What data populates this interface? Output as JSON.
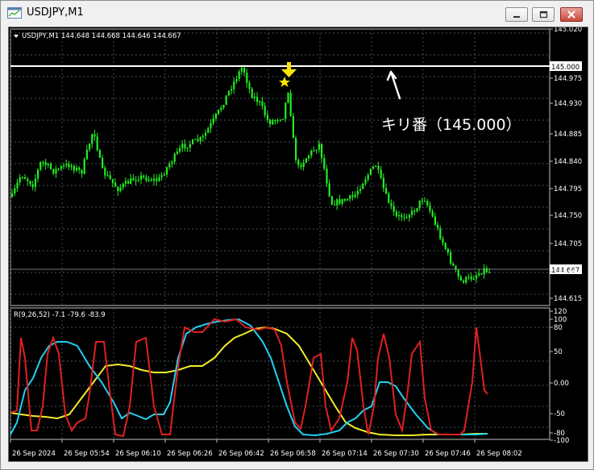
{
  "window": {
    "title": "USDJPY,M1"
  },
  "chart": {
    "header": "USDJPY,M1  144.648 144.668 144.646 144.667",
    "price_axis": {
      "ticks": [
        "145.020",
        "144.975",
        "144.930",
        "144.885",
        "144.840",
        "144.795",
        "144.750",
        "144.705",
        "144.660",
        "144.615"
      ],
      "level_label": "145.000",
      "current_label": "144.667"
    },
    "annotation": "キリ番（145.000）",
    "indicator": {
      "header": "R(9,26,52) -7.1 -79.6 -83.9",
      "ticks": [
        "120",
        "100",
        "80",
        "50",
        "0.00",
        "-50",
        "-80",
        "-100"
      ]
    },
    "time_axis": [
      "26 Sep 2024",
      "26 Sep 05:54",
      "26 Sep 06:10",
      "26 Sep 06:26",
      "26 Sep 06:42",
      "26 Sep 06:58",
      "26 Sep 07:14",
      "26 Sep 07:30",
      "26 Sep 07:46",
      "26 Sep 08:02"
    ]
  },
  "colors": {
    "background": "#000000",
    "candles": "#22ee22",
    "grid": "#5a6a7a",
    "level_line": "#ffffff",
    "marker": "#ffe600",
    "line_fast": "#e02020",
    "line_mid": "#22d0f0",
    "line_slow": "#f2ec2a"
  },
  "icons": [
    "window-app-icon",
    "minimize-icon",
    "maximize-icon",
    "close-icon",
    "arrow-down-marker-icon",
    "star-marker-icon"
  ]
}
